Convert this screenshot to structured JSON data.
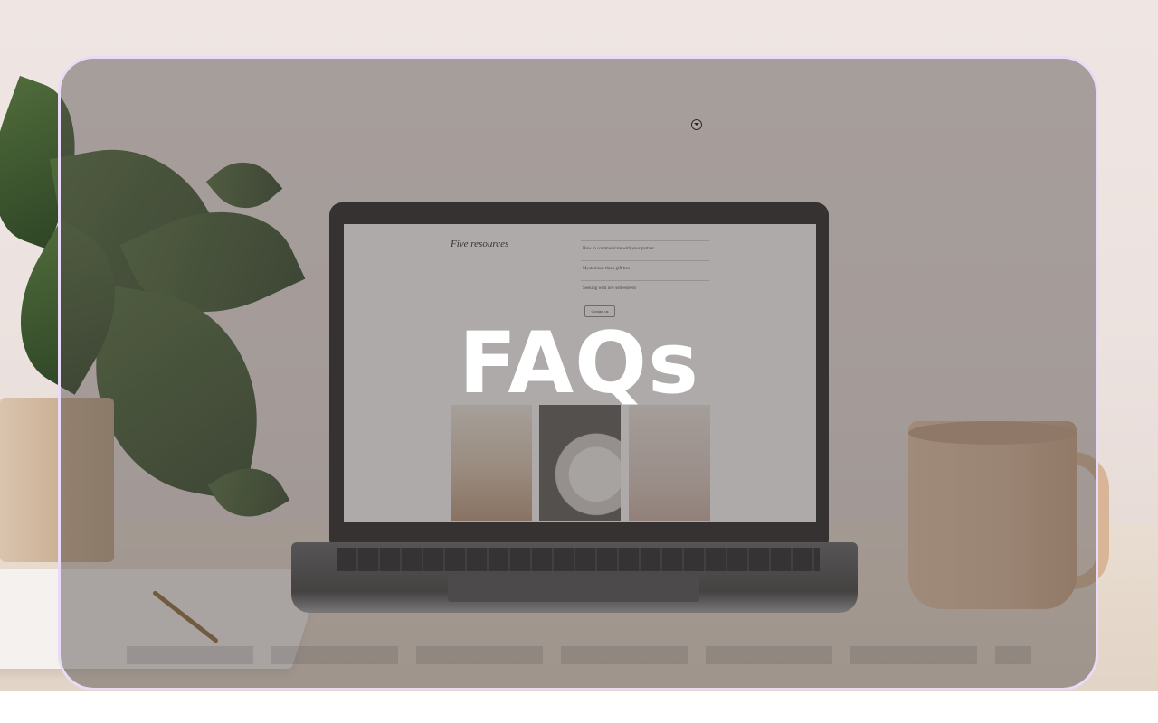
{
  "hero": {
    "title": "FAQs",
    "background_icon": "chevron-down-circle-icon"
  },
  "laptop_screen": {
    "site_title": "Five resources",
    "faq_rows": [
      "How to communicate with your partner",
      "Mysterious: this's gift box",
      "Seeking with low self-esteem"
    ],
    "button_label": "Contact us"
  },
  "colors": {
    "card_border": "#e9dbf7",
    "overlay": "#504a48",
    "title": "#ffffff"
  }
}
